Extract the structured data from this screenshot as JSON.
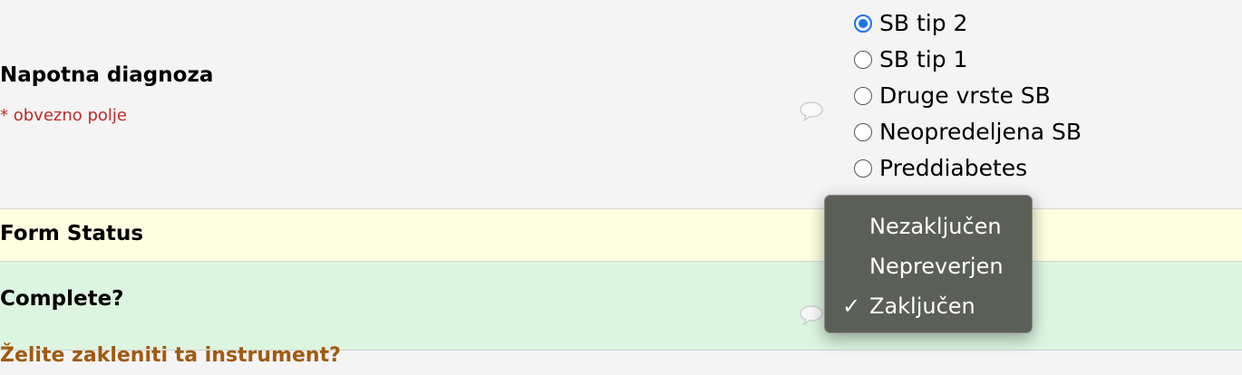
{
  "diagnosis": {
    "label": "Napotna diagnoza",
    "required_note": "* obvezno polje",
    "options": [
      {
        "label": "SB tip 2",
        "checked": true
      },
      {
        "label": "SB tip 1",
        "checked": false
      },
      {
        "label": "Druge vrste SB",
        "checked": false
      },
      {
        "label": "Neopredeljena SB",
        "checked": false
      },
      {
        "label": "Preddiabetes",
        "checked": false
      }
    ],
    "comment_icon": "comment-bubble-icon"
  },
  "form_status": {
    "label": "Form Status"
  },
  "complete": {
    "label": "Complete?",
    "comment_icon": "comment-bubble-icon",
    "dropdown_options": [
      {
        "label": "Nezaključen",
        "selected": false
      },
      {
        "label": "Nepreverjen",
        "selected": false
      },
      {
        "label": "Zaključen",
        "selected": true
      }
    ],
    "check_glyph": "✓"
  },
  "lock": {
    "label": "Želite zakleniti ta instrument?"
  },
  "colors": {
    "status_bg": "#fefee0",
    "complete_bg": "#dcf5e0",
    "required": "#c0282a",
    "lock_link": "#a05a10",
    "radio_accent": "#1a73e8",
    "dropdown_bg": "#5b5f58"
  }
}
